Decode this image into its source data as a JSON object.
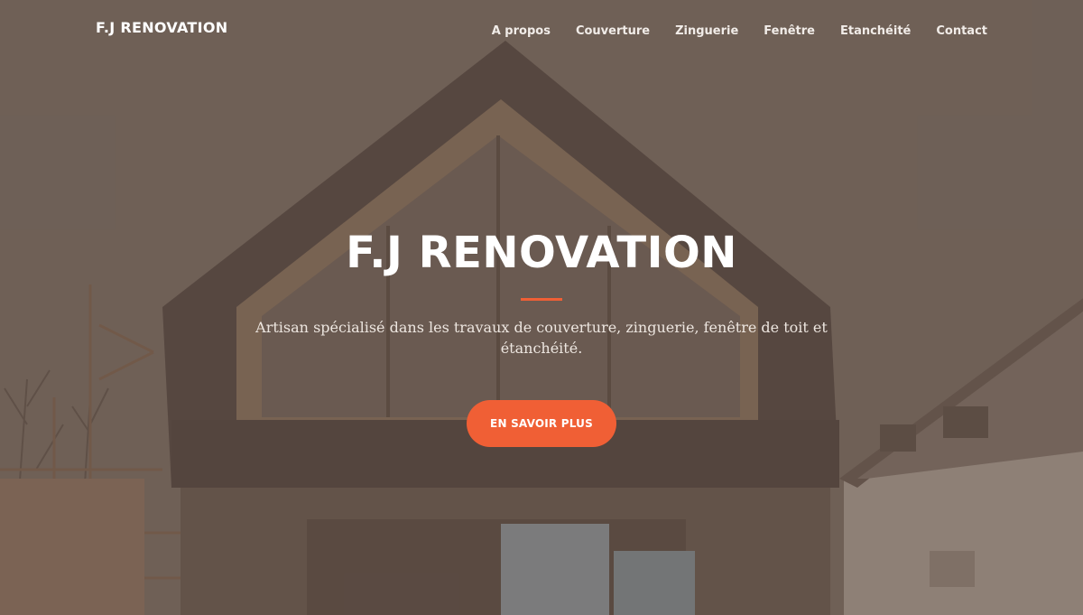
{
  "navbar": {
    "brand": "F.J RENOVATION",
    "links": [
      {
        "label": "A propos"
      },
      {
        "label": "Couverture"
      },
      {
        "label": "Zinguerie"
      },
      {
        "label": "Fenêtre"
      },
      {
        "label": "Etanchéité"
      },
      {
        "label": "Contact"
      }
    ]
  },
  "hero": {
    "title": "F.J RENOVATION",
    "subtitle": "Artisan spécialisé dans les travaux de couverture, zinguerie, fenêtre de toit et étanchéité.",
    "cta_label": "EN SAVOIR PLUS"
  },
  "colors": {
    "accent": "#f05f35",
    "overlay": "#5c4a40",
    "text": "#ffffff"
  }
}
